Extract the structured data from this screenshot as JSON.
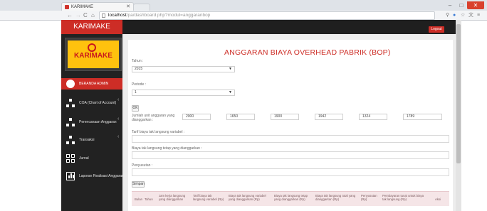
{
  "browser": {
    "tab_title": "KARIMAKE",
    "url_host": "localhost",
    "url_path": "/pa/dashboard.php?modul=anggaranbop",
    "icons": [
      "back-icon",
      "forward-icon",
      "reload-icon",
      "home-icon",
      "zoom-icon",
      "extension-icon",
      "star-icon",
      "translate-icon",
      "menu-icon"
    ]
  },
  "app": {
    "brand": "KARIMAKE",
    "logo_text": "KARIMAKE",
    "logout_label": "Logout"
  },
  "sidebar": {
    "items": [
      {
        "label": "BERANDA ADMIN",
        "icon": "dashboard-icon",
        "active": true
      },
      {
        "label": "COA (Chart of Account)",
        "icon": "sitemap-icon",
        "active": false
      },
      {
        "label": "Perencanaan Anggaran",
        "icon": "sitemap-icon",
        "active": false
      },
      {
        "label": "Transaksi",
        "icon": "sitemap-icon",
        "active": false
      },
      {
        "label": "Jurnal",
        "icon": "grid-icon",
        "active": false
      },
      {
        "label": "Laporan Realisasi Anggaran",
        "icon": "bar-chart-icon",
        "active": false
      }
    ]
  },
  "form": {
    "title": "ANGGARAN BIAYA OVERHEAD PABRIK (BOP)",
    "tahun_label": "Tahun :",
    "tahun_value": "2015",
    "periode_label": "Periode :",
    "periode_value": "1",
    "ok_label": "OK",
    "jumlah_label": "Jumlah unit anggaran yang dianggarkan :",
    "jumlah_values": [
      "2000",
      "1650",
      "1900",
      "1942",
      "1324",
      "1789"
    ],
    "tarif_label": "Tarif biaya tak langsung variabel :",
    "biaya_label": "Biaya tak langsung tetap yang dianggarkan :",
    "penyusutan_label": "Penyusutan :",
    "simpan_label": "Simpan",
    "table_headers": [
      "Bulan",
      "Tahun",
      "Jam kerja langsung yang dianggarkan",
      "Tarif biaya tak langsung variabel (Rp)",
      "Biaya tak langsung variabel yang dianggarkan (Rp)",
      "Biaya tak langsung tetap yang dianggarkan (Rp)",
      "Biaya tak langsung total yang dianggarkan (Rp)",
      "Penyusutan (Rp)",
      "Pembayaran tunai untuk biaya tak langsung (Rp)",
      "Aksi"
    ]
  },
  "colors": {
    "brand_red": "#cd2d26",
    "sidebar_bg": "#222222",
    "logo_yellow": "#ffc20e"
  }
}
